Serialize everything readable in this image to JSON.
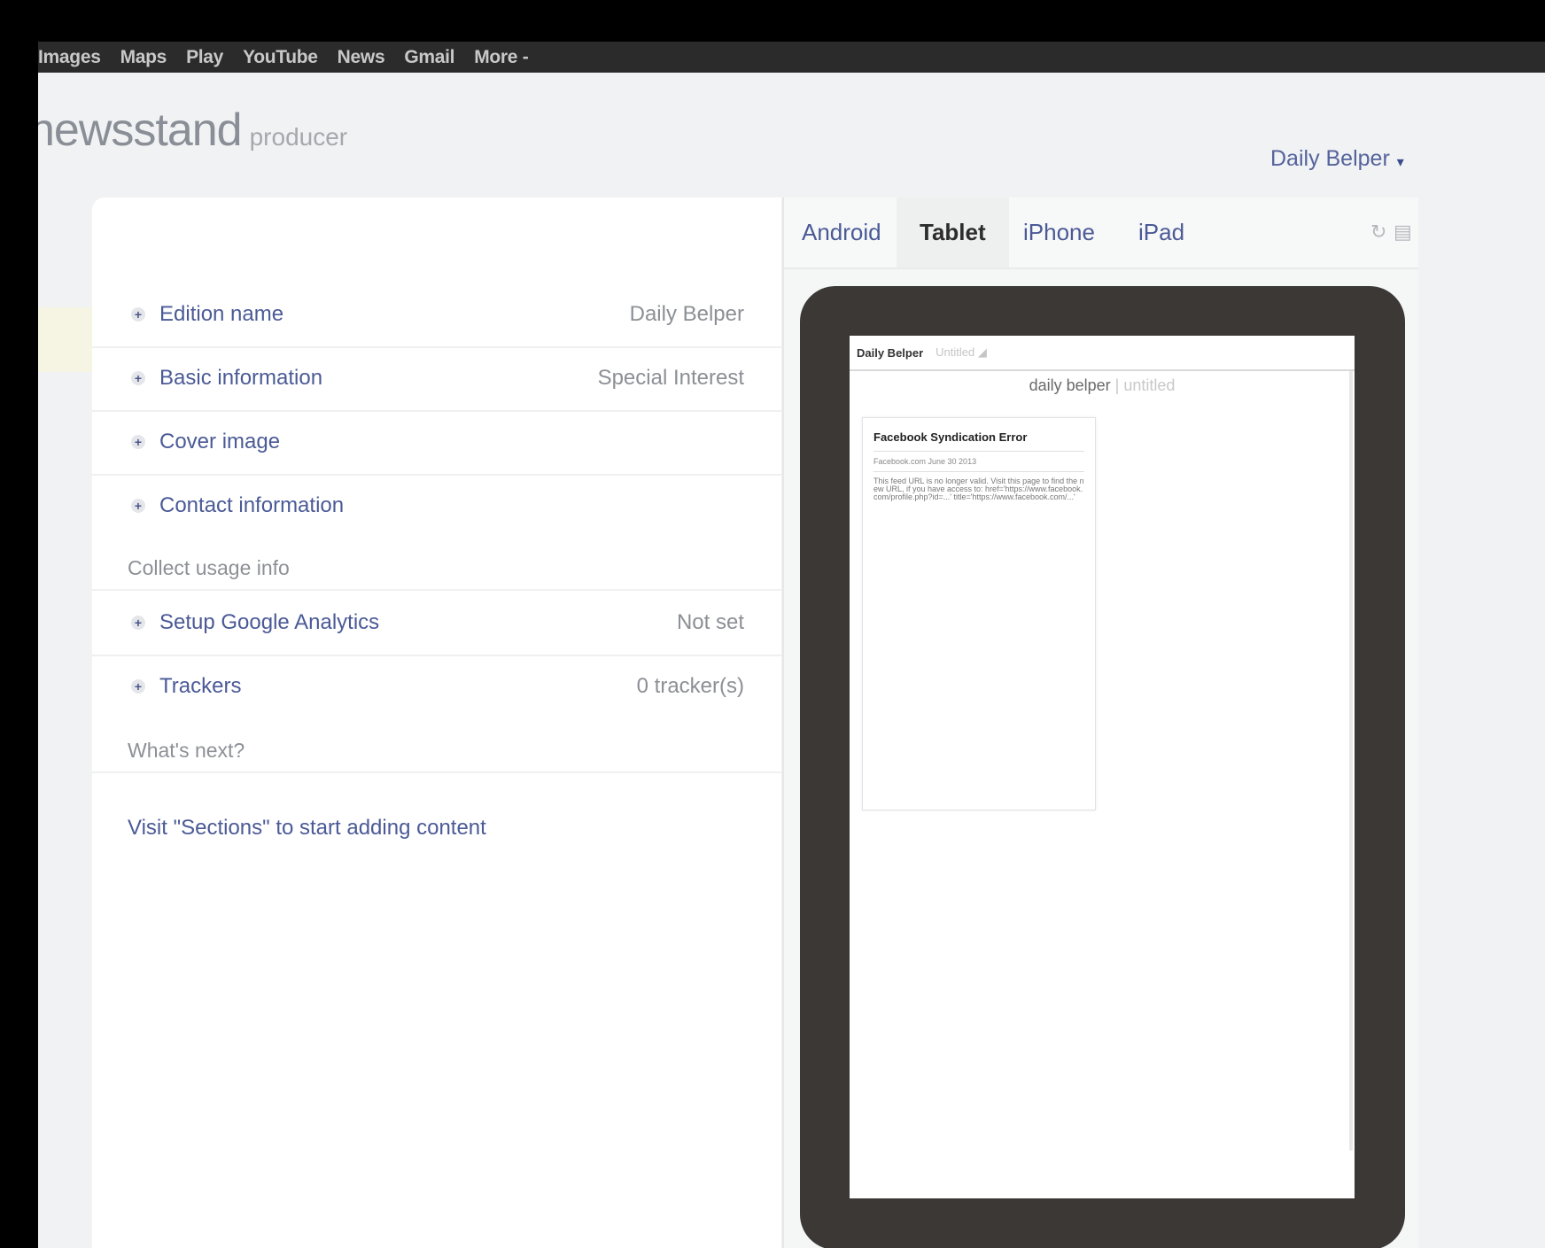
{
  "google_bar": [
    "Images",
    "Maps",
    "Play",
    "YouTube",
    "News",
    "Gmail",
    "More -"
  ],
  "brand": {
    "name": "newsstand",
    "sub": "producer"
  },
  "edition_selector": {
    "label": "Daily Belper",
    "arrow": "▾"
  },
  "settings": {
    "rows": [
      {
        "label": "Edition name",
        "value": "Daily Belper"
      },
      {
        "label": "Basic information",
        "value": "Special Interest"
      },
      {
        "label": "Cover image",
        "value": ""
      },
      {
        "label": "Contact information",
        "value": ""
      }
    ],
    "usage_heading": "Collect usage info",
    "usage_rows": [
      {
        "label": "Setup Google Analytics",
        "value": "Not set"
      },
      {
        "label": "Trackers",
        "value": "0 tracker(s)"
      }
    ],
    "next_heading": "What's next?",
    "next_link": "Visit \"Sections\" to start adding content",
    "plus_icon": "+"
  },
  "preview": {
    "tabs": [
      "Android",
      "Tablet",
      "iPhone",
      "iPad"
    ],
    "active_tab": "Tablet",
    "tools": [
      "refresh-icon",
      "screenshot-icon"
    ],
    "device": {
      "top_name": "Daily Belper",
      "top_sub": "Untitled ◢",
      "title_main": "daily belper",
      "title_sep": " | ",
      "title_sub": "untitled",
      "card_title": "Facebook Syndication Error",
      "card_subtitle": "Facebook.com June 30 2013",
      "card_body": "This feed URL is no longer valid. Visit this page to find the new URL, if you have access to: href='https://www.facebook.com/profile.php?id=...' title='https://www.facebook.com/...'"
    }
  },
  "colors": {
    "link": "#4b5a96",
    "muted": "#8c8f95",
    "background": "#f1f2f3",
    "device_frame": "#3b3836"
  }
}
